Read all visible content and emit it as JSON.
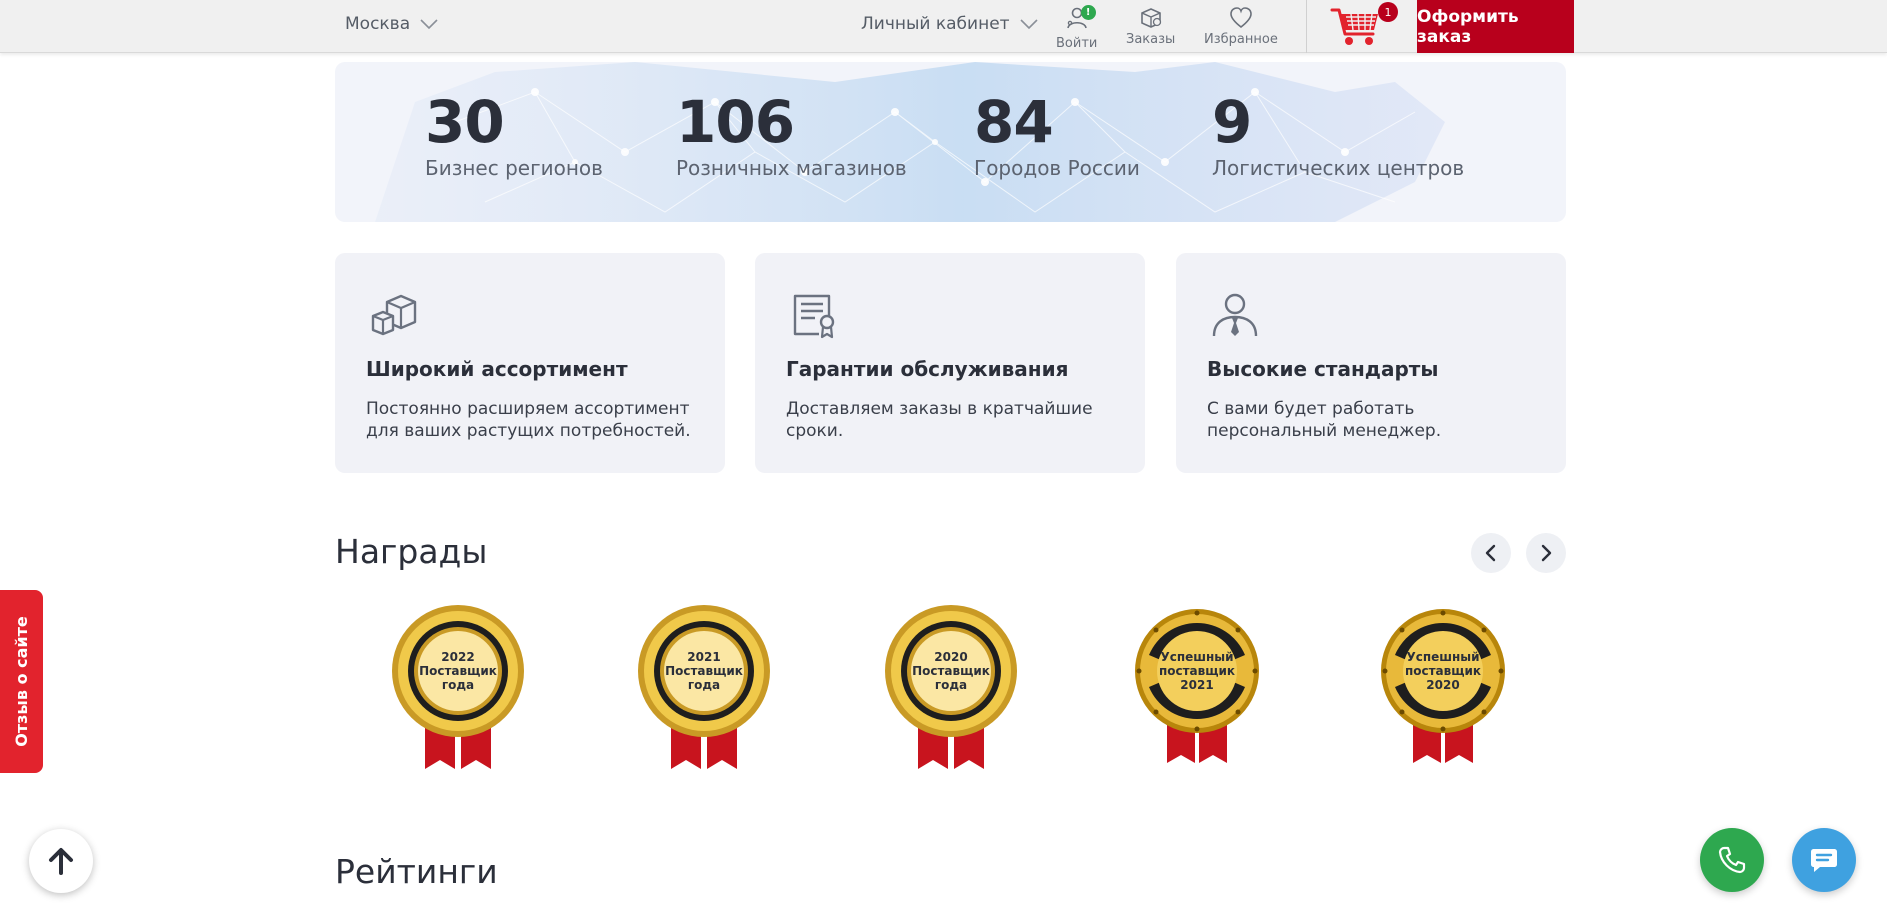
{
  "header": {
    "city": "Москва",
    "cabinet": "Личный кабинет",
    "login_label": "Войти",
    "login_badge": "!",
    "orders_label": "Заказы",
    "favorites_label": "Избранное",
    "cart_count": "1",
    "order_button": "Оформить заказ"
  },
  "stats": [
    {
      "number": "30",
      "caption": "Бизнес регионов"
    },
    {
      "number": "106",
      "caption": "Розничных магазинов"
    },
    {
      "number": "84",
      "caption": "Городов России"
    },
    {
      "number": "9",
      "caption": "Логистических центров"
    }
  ],
  "features": [
    {
      "icon": "boxes-icon",
      "title": "Широкий ассортимент",
      "text": "Постоянно расширяем ассортимент для ваших растущих потребностей."
    },
    {
      "icon": "certificate-icon",
      "title": "Гарантии обслуживания",
      "text": "Доставляем заказы в кратчайшие сроки."
    },
    {
      "icon": "manager-icon",
      "title": "Высокие стандарты",
      "text": "С вами будет работать персональный менеджер."
    }
  ],
  "awards": {
    "title": "Награды",
    "items": [
      {
        "line1": "2022",
        "line2": "Поставщик",
        "line3": "года"
      },
      {
        "line1": "2021",
        "line2": "Поставщик",
        "line3": "года"
      },
      {
        "line1": "2020",
        "line2": "Поставщик",
        "line3": "года"
      },
      {
        "line1": "Успешный",
        "line2": "поставщик",
        "line3": "2021"
      },
      {
        "line1": "Успешный",
        "line2": "поставщик",
        "line3": "2020"
      }
    ]
  },
  "ratings": {
    "title": "Рейтинги"
  },
  "feedback_tab": "Отзыв о сайте",
  "colors": {
    "brand_red": "#b8001c",
    "phone_green": "#2ea84f",
    "chat_blue": "#3fa1e0"
  }
}
